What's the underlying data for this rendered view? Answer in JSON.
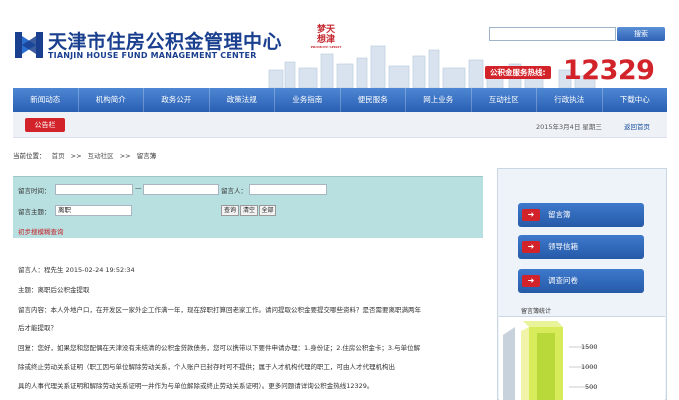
{
  "header": {
    "logo_cn": "天津市住房公积金管理中心",
    "logo_en": "TIANJIN HOUSE FUND MANAGEMENT CENTER",
    "seal_chars": [
      "梦天",
      "想津"
    ],
    "seal_sub": "PROMOTE SPIRIT",
    "search_button": "搜索",
    "hotline_label": "公积金服务热线:",
    "hotline_number": "12329"
  },
  "nav": {
    "items": [
      "新闻动态",
      "机构简介",
      "政务公开",
      "政策法规",
      "业务指南",
      "便民服务",
      "网上业务",
      "互动社区",
      "行政执法",
      "下载中心"
    ]
  },
  "subbar": {
    "notice": "公告栏",
    "date": "2015年3月4日",
    "weekday": "星期三",
    "home": "返回首页"
  },
  "breadcrumb": {
    "label": "当前位置：",
    "items": [
      "首页",
      "互动社区",
      "留言簿"
    ],
    "separator": ">>"
  },
  "search_form": {
    "time_label": "留言时间：",
    "date_sep": "—",
    "author_label": "留言人：",
    "topic_label": "留言主题：",
    "topic_value": "离职",
    "query_button": "查询",
    "clear_button": "清空",
    "all_button": "全部",
    "advanced_link": "初步搜模糊查询"
  },
  "message": {
    "author_line": "留言人：程先生 2015-02-24 19:52:34",
    "topic_line": "主题：离职后公积金提取",
    "content_line1": "留言内容：本人外地户口，在开发区一家外企工作满一年，现在辞职打算回老家工作。请问提取公积金要提交哪些资料？是否需要离职满两年",
    "content_line2": "后才能提取？",
    "reply_line1": "回复：您好，如果您和您配偶在天津没有未结清的公积金贷款债务，您可以携带以下要件申请办理：1.身份证；2.住房公积金卡；3.与单位解",
    "reply_line2": "除或终止劳动关系证明（职工因与单位解除劳动关系，个人账户已封存时可不提供；属于人才机构代理的职工，可由人才代理机构出",
    "reply_line3": "具的人事代理关系证明和解除劳动关系证明一并作为与单位解除或终止劳动关系证明）。更多问题请详询公积金热线12329。"
  },
  "sidebar": {
    "buttons": [
      "留言簿",
      "领导信箱",
      "调查问卷"
    ],
    "stats_title": "留言簿统计",
    "y_ticks": [
      "1500",
      "1000",
      "500"
    ]
  },
  "colors": {
    "brand_blue": "#2a5fb3",
    "brand_red": "#d2232a",
    "form_teal": "#b9e0e0"
  }
}
